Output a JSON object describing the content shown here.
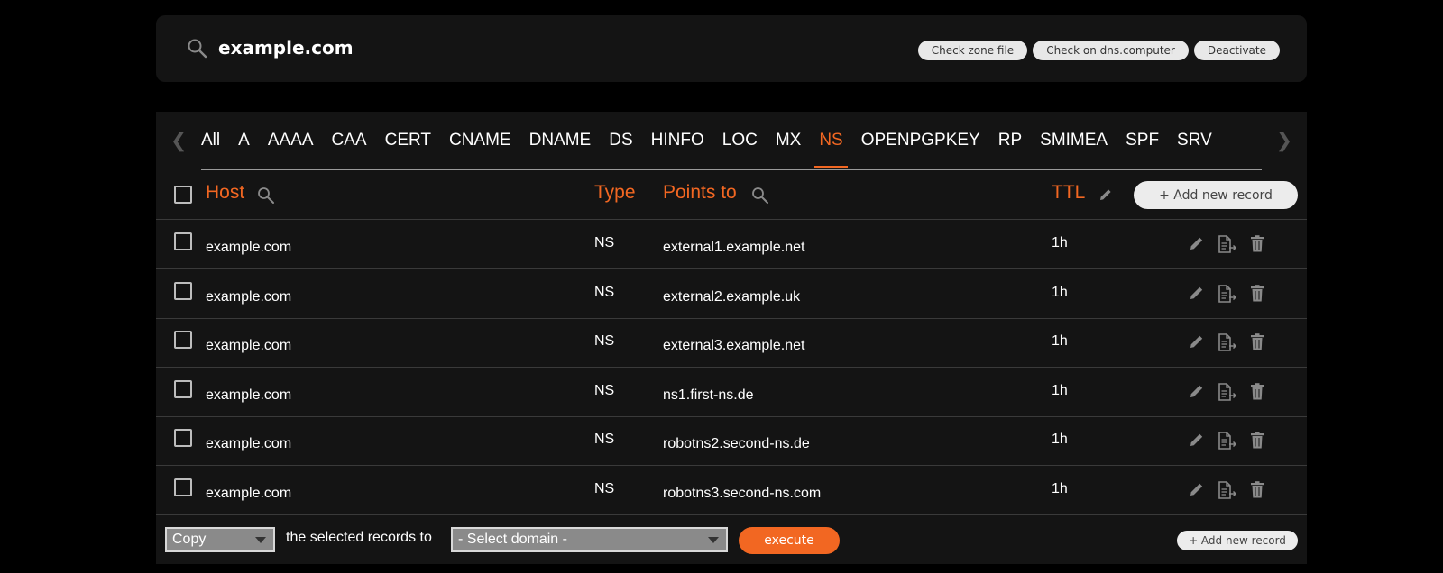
{
  "header": {
    "domain": "example.com",
    "buttons": [
      "Check zone file",
      "Check on dns.computer",
      "Deactivate"
    ]
  },
  "tabs": {
    "items": [
      "All",
      "A",
      "AAAA",
      "CAA",
      "CERT",
      "CNAME",
      "DNAME",
      "DS",
      "HINFO",
      "LOC",
      "MX",
      "NS",
      "OPENPGPKEY",
      "RP",
      "SMIMEA",
      "SPF",
      "SRV"
    ],
    "active": "NS"
  },
  "table": {
    "headers": {
      "host": "Host",
      "type": "Type",
      "points_to": "Points to",
      "ttl": "TTL"
    },
    "add_record_label": "+ Add new record",
    "rows": [
      {
        "host": "example.com",
        "type": "NS",
        "target": "external1.example.net",
        "ttl": "1h"
      },
      {
        "host": "example.com",
        "type": "NS",
        "target": "external2.example.uk",
        "ttl": "1h"
      },
      {
        "host": "example.com",
        "type": "NS",
        "target": "external3.example.net",
        "ttl": "1h"
      },
      {
        "host": "example.com",
        "type": "NS",
        "target": "ns1.first-ns.de",
        "ttl": "1h"
      },
      {
        "host": "example.com",
        "type": "NS",
        "target": "robotns2.second-ns.de",
        "ttl": "1h"
      },
      {
        "host": "example.com",
        "type": "NS",
        "target": "robotns3.second-ns.com",
        "ttl": "1h"
      }
    ],
    "row_action_icons": [
      "pencil-icon",
      "copy-document-icon",
      "trash-icon"
    ]
  },
  "footer": {
    "action_select": "Copy",
    "middle_text": "the selected records to",
    "domain_select": "- Select domain -",
    "execute_label": "execute",
    "add_record_label": "+ Add new record"
  },
  "colors": {
    "accent": "#f26722",
    "panel": "#141414",
    "background": "#000000"
  }
}
